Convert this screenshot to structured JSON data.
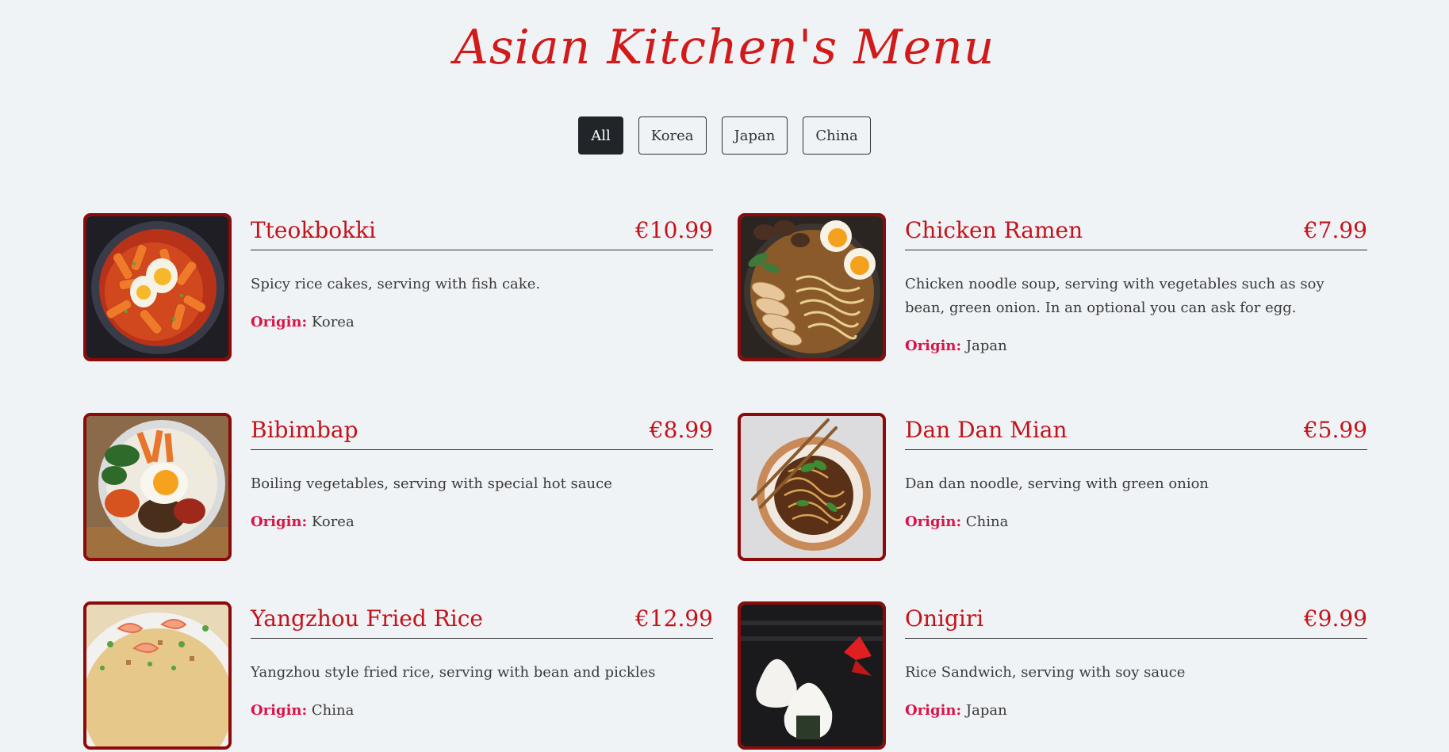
{
  "page": {
    "title": "Asian Kitchen's Menu"
  },
  "filters": [
    {
      "label": "All",
      "active": true
    },
    {
      "label": "Korea",
      "active": false
    },
    {
      "label": "Japan",
      "active": false
    },
    {
      "label": "China",
      "active": false
    }
  ],
  "origin_label": "Origin:",
  "items": [
    {
      "name": "Tteokbokki",
      "price": "€10.99",
      "description": "Spicy rice cakes, serving with fish cake.",
      "origin": "Korea",
      "image": "tteokbokki-photo"
    },
    {
      "name": "Chicken Ramen",
      "price": "€7.99",
      "description": "Chicken noodle soup, serving with vegetables such as soy bean, green onion. In an optional you can ask for egg.",
      "origin": "Japan",
      "image": "chicken-ramen-photo"
    },
    {
      "name": "Bibimbap",
      "price": "€8.99",
      "description": "Boiling vegetables, serving with special hot sauce",
      "origin": "Korea",
      "image": "bibimbap-photo"
    },
    {
      "name": "Dan Dan Mian",
      "price": "€5.99",
      "description": "Dan dan noodle, serving with green onion",
      "origin": "China",
      "image": "dan-dan-mian-photo"
    },
    {
      "name": "Yangzhou Fried Rice",
      "price": "€12.99",
      "description": "Yangzhou style fried rice, serving with bean and pickles",
      "origin": "China",
      "image": "yangzhou-fried-rice-photo"
    },
    {
      "name": "Onigiri",
      "price": "€9.99",
      "description": "Rice Sandwich, serving with soy sauce",
      "origin": "Japan",
      "image": "onigiri-photo"
    }
  ],
  "colors": {
    "background": "#f0f3f6",
    "accent": "#c3131a",
    "origin_label": "#d81446",
    "image_border": "#8b0a0a",
    "active_filter": "#212529"
  }
}
